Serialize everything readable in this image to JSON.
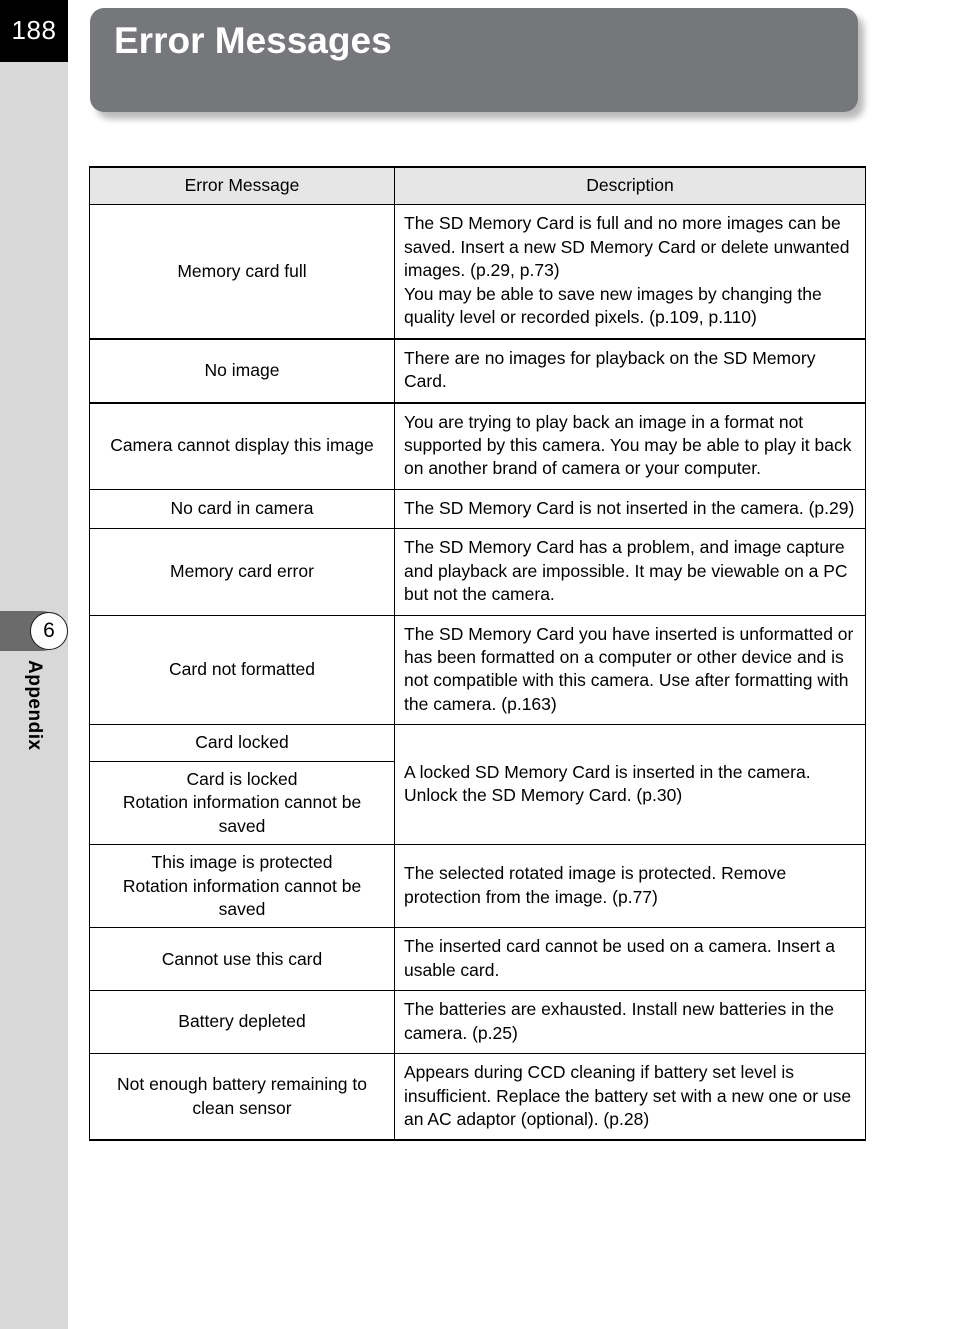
{
  "page": {
    "number": "188",
    "title": "Error Messages",
    "chapter_number": "6",
    "chapter_label": "Appendix",
    "banner_color": "#76777b",
    "rail_color": "#d8d8d8",
    "header_fill": "#e6e6e6"
  },
  "table": {
    "headers": {
      "message": "Error Message",
      "description": "Description"
    },
    "rows": [
      {
        "message": "Memory card full",
        "description": "The SD Memory Card is full and no more images can be saved. Insert a new SD Memory Card or delete unwanted images. (p.29, p.73)\nYou may be able to save new images by changing the quality level or recorded pixels. (p.109, p.110)"
      },
      {
        "message": "No image",
        "description": "There are no images for playback on the SD Memory Card."
      },
      {
        "message": "Camera cannot display this image",
        "description": "You are trying to play back an image in a format not supported by this camera. You may be able to play it back on another brand of camera or your computer."
      },
      {
        "message": "No card in camera",
        "description": "The SD Memory Card is not inserted in the camera. (p.29)"
      },
      {
        "message": "Memory card error",
        "description": "The SD Memory Card has a problem, and image capture and playback are impossible. It may be viewable on a PC but not the camera."
      },
      {
        "message": "Card not formatted",
        "description": "The SD Memory Card you have inserted is unformatted or has been formatted on a computer or other device and is not compatible with this camera. Use after formatting with the camera. (p.163)"
      },
      {
        "message": "Card locked",
        "description": "A locked SD Memory Card is inserted in the camera. Unlock the SD Memory Card. (p.30)",
        "description_rowspan": 2
      },
      {
        "message": "Card is locked\nRotation information cannot be saved",
        "description": null
      },
      {
        "message": "This image is protected\nRotation information cannot be saved",
        "description": "The selected rotated image is protected. Remove protection from the image. (p.77)"
      },
      {
        "message": "Cannot use this card",
        "description": "The inserted card cannot be used on a camera. Insert a usable card."
      },
      {
        "message": "Battery depleted",
        "description": "The batteries are exhausted. Install new batteries in the camera. (p.25)"
      },
      {
        "message": "Not enough battery remaining to clean sensor",
        "description": "Appears during CCD cleaning if battery set level is insufficient. Replace the battery set with a new one or use an AC adaptor (optional). (p.28)"
      }
    ]
  }
}
